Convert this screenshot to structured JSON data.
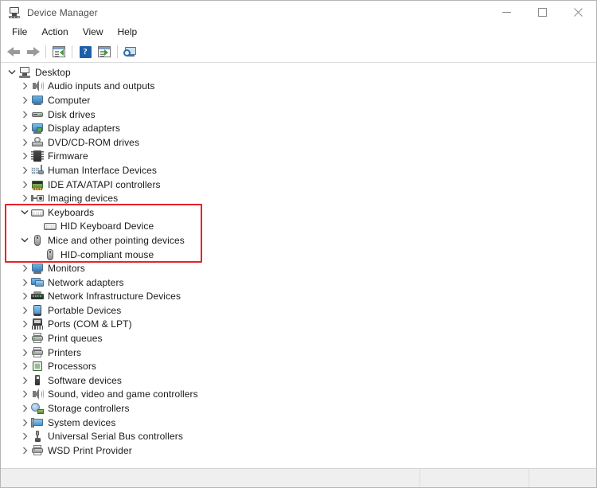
{
  "window": {
    "title": "Device Manager",
    "title_icon": "device-manager-icon",
    "controls": {
      "minimize": "minimize-icon",
      "maximize": "maximize-icon",
      "close": "close-icon"
    }
  },
  "menubar": {
    "items": [
      {
        "label": "File"
      },
      {
        "label": "Action"
      },
      {
        "label": "View"
      },
      {
        "label": "Help"
      }
    ]
  },
  "toolbar": {
    "buttons": [
      {
        "name": "back-button",
        "icon": "back-arrow-icon"
      },
      {
        "name": "forward-button",
        "icon": "forward-arrow-icon"
      },
      {
        "name": "properties-button",
        "icon": "properties-panel-icon"
      },
      {
        "name": "help-button",
        "icon": "question-mark-icon"
      },
      {
        "name": "scan-hardware-changes-button",
        "icon": "panel-play-icon"
      },
      {
        "name": "show-hidden-devices-button",
        "icon": "monitor-scan-icon"
      }
    ]
  },
  "tree": {
    "nodes": [
      {
        "label": "Desktop",
        "depth": 0,
        "state": "expanded",
        "icon": "desktop-icon"
      },
      {
        "label": "Audio inputs and outputs",
        "depth": 1,
        "state": "collapsed",
        "icon": "speaker-icon"
      },
      {
        "label": "Computer",
        "depth": 1,
        "state": "collapsed",
        "icon": "monitor-icon"
      },
      {
        "label": "Disk drives",
        "depth": 1,
        "state": "collapsed",
        "icon": "disk-drive-icon"
      },
      {
        "label": "Display adapters",
        "depth": 1,
        "state": "collapsed",
        "icon": "display-adapter-icon"
      },
      {
        "label": "DVD/CD-ROM drives",
        "depth": 1,
        "state": "collapsed",
        "icon": "dvd-drive-icon"
      },
      {
        "label": "Firmware",
        "depth": 1,
        "state": "collapsed",
        "icon": "firmware-chip-icon"
      },
      {
        "label": "Human Interface Devices",
        "depth": 1,
        "state": "collapsed",
        "icon": "hid-icon"
      },
      {
        "label": "IDE ATA/ATAPI controllers",
        "depth": 1,
        "state": "collapsed",
        "icon": "ide-controller-icon"
      },
      {
        "label": "Imaging devices",
        "depth": 1,
        "state": "collapsed",
        "icon": "imaging-device-icon"
      },
      {
        "label": "Keyboards",
        "depth": 1,
        "state": "expanded",
        "icon": "keyboard-icon"
      },
      {
        "label": "HID Keyboard Device",
        "depth": 2,
        "state": "leaf",
        "icon": "keyboard-icon"
      },
      {
        "label": "Mice and other pointing devices",
        "depth": 1,
        "state": "expanded",
        "icon": "mouse-icon"
      },
      {
        "label": "HID-compliant mouse",
        "depth": 2,
        "state": "leaf",
        "icon": "mouse-icon"
      },
      {
        "label": "Monitors",
        "depth": 1,
        "state": "collapsed",
        "icon": "monitor-icon"
      },
      {
        "label": "Network adapters",
        "depth": 1,
        "state": "collapsed",
        "icon": "network-adapter-icon"
      },
      {
        "label": "Network Infrastructure Devices",
        "depth": 1,
        "state": "collapsed",
        "icon": "network-infrastructure-icon"
      },
      {
        "label": "Portable Devices",
        "depth": 1,
        "state": "collapsed",
        "icon": "portable-device-icon"
      },
      {
        "label": "Ports (COM & LPT)",
        "depth": 1,
        "state": "collapsed",
        "icon": "port-icon"
      },
      {
        "label": "Print queues",
        "depth": 1,
        "state": "collapsed",
        "icon": "printer-icon"
      },
      {
        "label": "Printers",
        "depth": 1,
        "state": "collapsed",
        "icon": "printer-icon"
      },
      {
        "label": "Processors",
        "depth": 1,
        "state": "collapsed",
        "icon": "processor-icon"
      },
      {
        "label": "Software devices",
        "depth": 1,
        "state": "collapsed",
        "icon": "software-device-icon"
      },
      {
        "label": "Sound, video and game controllers",
        "depth": 1,
        "state": "collapsed",
        "icon": "speaker-icon"
      },
      {
        "label": "Storage controllers",
        "depth": 1,
        "state": "collapsed",
        "icon": "storage-controller-icon"
      },
      {
        "label": "System devices",
        "depth": 1,
        "state": "collapsed",
        "icon": "system-device-icon"
      },
      {
        "label": "Universal Serial Bus controllers",
        "depth": 1,
        "state": "collapsed",
        "icon": "usb-icon"
      },
      {
        "label": "WSD Print Provider",
        "depth": 1,
        "state": "collapsed",
        "icon": "printer-icon"
      }
    ]
  },
  "annotation": {
    "highlight": {
      "name": "red-highlight-box",
      "color": "#e8232a",
      "covers": [
        "Keyboards",
        "HID Keyboard Device",
        "Mice and other pointing devices",
        "HID-compliant mouse"
      ]
    }
  },
  "statusbar": {
    "segments": [
      "",
      "",
      ""
    ]
  }
}
